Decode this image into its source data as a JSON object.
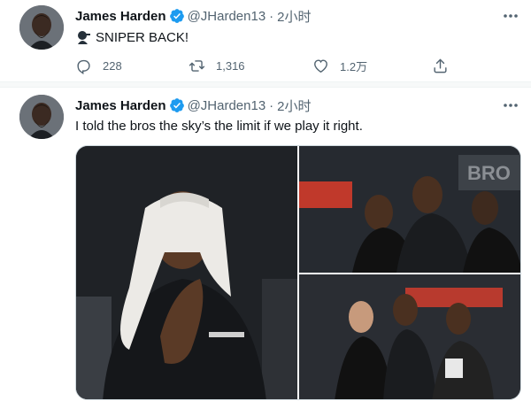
{
  "colors": {
    "verified": "#1d9bf0",
    "muted": "#536471",
    "text": "#0f1419",
    "divider": "#eff3f4"
  },
  "tweets": [
    {
      "author": {
        "name": "James Harden",
        "handle": "@JHarden13",
        "verified_icon": "verified-badge-icon",
        "avatar": "avatar-photo"
      },
      "separator": "·",
      "time": "2小时",
      "emoji": "sniper-emoji-icon",
      "text": "SNIPER BACK!",
      "actions": {
        "replies": "228",
        "retweets": "1,316",
        "likes": "1.2万"
      }
    },
    {
      "author": {
        "name": "James Harden",
        "handle": "@JHarden13",
        "verified_icon": "verified-badge-icon",
        "avatar": "avatar-photo"
      },
      "separator": "·",
      "time": "2小时",
      "text": "I told the bros the sky’s the limit if we play it right.",
      "media": {
        "photos": [
          {
            "name": "photo-player-with-towel"
          },
          {
            "name": "photo-bench-players"
          },
          {
            "name": "photo-bench-players-2"
          }
        ]
      }
    }
  ]
}
